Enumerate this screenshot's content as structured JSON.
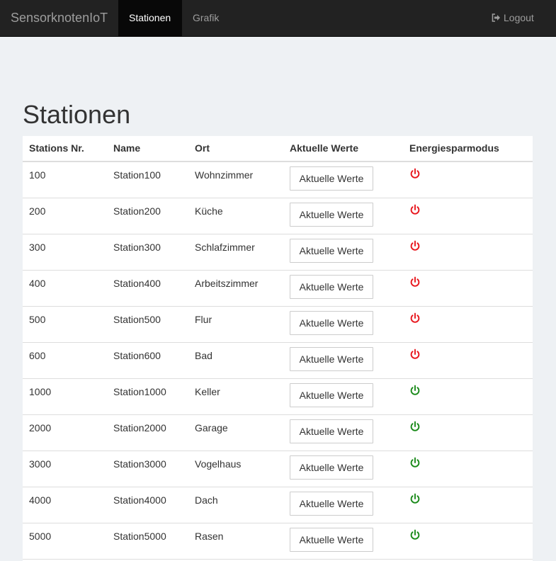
{
  "nav": {
    "brand": "SensorknotenIoT",
    "links": [
      "Stationen",
      "Grafik"
    ],
    "logout": "Logout"
  },
  "page": {
    "title": "Stationen"
  },
  "table": {
    "headers": [
      "Stations Nr.",
      "Name",
      "Ort",
      "Aktuelle Werte",
      "Energiesparmodus"
    ],
    "button_label": "Aktuelle Werte",
    "rows": [
      {
        "nr": "100",
        "name": "Station100",
        "ort": "Wohnzimmer",
        "energy": "off"
      },
      {
        "nr": "200",
        "name": "Station200",
        "ort": "Küche",
        "energy": "off"
      },
      {
        "nr": "300",
        "name": "Station300",
        "ort": "Schlafzimmer",
        "energy": "off"
      },
      {
        "nr": "400",
        "name": "Station400",
        "ort": "Arbeitszimmer",
        "energy": "off"
      },
      {
        "nr": "500",
        "name": "Station500",
        "ort": "Flur",
        "energy": "off"
      },
      {
        "nr": "600",
        "name": "Station600",
        "ort": "Bad",
        "energy": "off"
      },
      {
        "nr": "1000",
        "name": "Station1000",
        "ort": "Keller",
        "energy": "on"
      },
      {
        "nr": "2000",
        "name": "Station2000",
        "ort": "Garage",
        "energy": "on"
      },
      {
        "nr": "3000",
        "name": "Station3000",
        "ort": "Vogelhaus",
        "energy": "on"
      },
      {
        "nr": "4000",
        "name": "Station4000",
        "ort": "Dach",
        "energy": "on"
      },
      {
        "nr": "5000",
        "name": "Station5000",
        "ort": "Rasen",
        "energy": "on"
      }
    ]
  },
  "colors": {
    "power_off": "#e8161d",
    "power_on": "#1a8a1a",
    "navbar_bg": "#222222"
  }
}
